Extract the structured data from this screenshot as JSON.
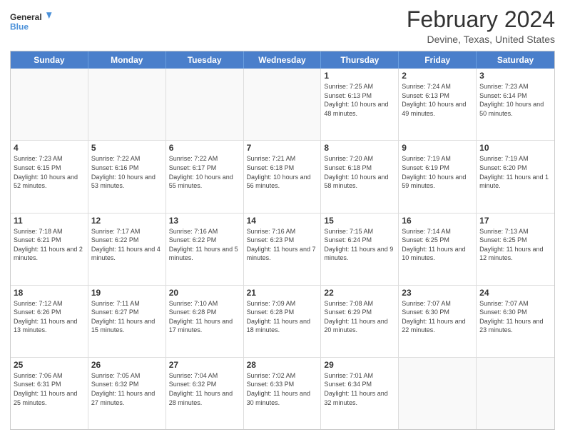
{
  "header": {
    "logo_line1": "General",
    "logo_line2": "Blue",
    "month": "February 2024",
    "location": "Devine, Texas, United States"
  },
  "days": [
    "Sunday",
    "Monday",
    "Tuesday",
    "Wednesday",
    "Thursday",
    "Friday",
    "Saturday"
  ],
  "weeks": [
    [
      {
        "day": "",
        "info": ""
      },
      {
        "day": "",
        "info": ""
      },
      {
        "day": "",
        "info": ""
      },
      {
        "day": "",
        "info": ""
      },
      {
        "day": "1",
        "info": "Sunrise: 7:25 AM\nSunset: 6:13 PM\nDaylight: 10 hours and 48 minutes."
      },
      {
        "day": "2",
        "info": "Sunrise: 7:24 AM\nSunset: 6:13 PM\nDaylight: 10 hours and 49 minutes."
      },
      {
        "day": "3",
        "info": "Sunrise: 7:23 AM\nSunset: 6:14 PM\nDaylight: 10 hours and 50 minutes."
      }
    ],
    [
      {
        "day": "4",
        "info": "Sunrise: 7:23 AM\nSunset: 6:15 PM\nDaylight: 10 hours and 52 minutes."
      },
      {
        "day": "5",
        "info": "Sunrise: 7:22 AM\nSunset: 6:16 PM\nDaylight: 10 hours and 53 minutes."
      },
      {
        "day": "6",
        "info": "Sunrise: 7:22 AM\nSunset: 6:17 PM\nDaylight: 10 hours and 55 minutes."
      },
      {
        "day": "7",
        "info": "Sunrise: 7:21 AM\nSunset: 6:18 PM\nDaylight: 10 hours and 56 minutes."
      },
      {
        "day": "8",
        "info": "Sunrise: 7:20 AM\nSunset: 6:18 PM\nDaylight: 10 hours and 58 minutes."
      },
      {
        "day": "9",
        "info": "Sunrise: 7:19 AM\nSunset: 6:19 PM\nDaylight: 10 hours and 59 minutes."
      },
      {
        "day": "10",
        "info": "Sunrise: 7:19 AM\nSunset: 6:20 PM\nDaylight: 11 hours and 1 minute."
      }
    ],
    [
      {
        "day": "11",
        "info": "Sunrise: 7:18 AM\nSunset: 6:21 PM\nDaylight: 11 hours and 2 minutes."
      },
      {
        "day": "12",
        "info": "Sunrise: 7:17 AM\nSunset: 6:22 PM\nDaylight: 11 hours and 4 minutes."
      },
      {
        "day": "13",
        "info": "Sunrise: 7:16 AM\nSunset: 6:22 PM\nDaylight: 11 hours and 5 minutes."
      },
      {
        "day": "14",
        "info": "Sunrise: 7:16 AM\nSunset: 6:23 PM\nDaylight: 11 hours and 7 minutes."
      },
      {
        "day": "15",
        "info": "Sunrise: 7:15 AM\nSunset: 6:24 PM\nDaylight: 11 hours and 9 minutes."
      },
      {
        "day": "16",
        "info": "Sunrise: 7:14 AM\nSunset: 6:25 PM\nDaylight: 11 hours and 10 minutes."
      },
      {
        "day": "17",
        "info": "Sunrise: 7:13 AM\nSunset: 6:25 PM\nDaylight: 11 hours and 12 minutes."
      }
    ],
    [
      {
        "day": "18",
        "info": "Sunrise: 7:12 AM\nSunset: 6:26 PM\nDaylight: 11 hours and 13 minutes."
      },
      {
        "day": "19",
        "info": "Sunrise: 7:11 AM\nSunset: 6:27 PM\nDaylight: 11 hours and 15 minutes."
      },
      {
        "day": "20",
        "info": "Sunrise: 7:10 AM\nSunset: 6:28 PM\nDaylight: 11 hours and 17 minutes."
      },
      {
        "day": "21",
        "info": "Sunrise: 7:09 AM\nSunset: 6:28 PM\nDaylight: 11 hours and 18 minutes."
      },
      {
        "day": "22",
        "info": "Sunrise: 7:08 AM\nSunset: 6:29 PM\nDaylight: 11 hours and 20 minutes."
      },
      {
        "day": "23",
        "info": "Sunrise: 7:07 AM\nSunset: 6:30 PM\nDaylight: 11 hours and 22 minutes."
      },
      {
        "day": "24",
        "info": "Sunrise: 7:07 AM\nSunset: 6:30 PM\nDaylight: 11 hours and 23 minutes."
      }
    ],
    [
      {
        "day": "25",
        "info": "Sunrise: 7:06 AM\nSunset: 6:31 PM\nDaylight: 11 hours and 25 minutes."
      },
      {
        "day": "26",
        "info": "Sunrise: 7:05 AM\nSunset: 6:32 PM\nDaylight: 11 hours and 27 minutes."
      },
      {
        "day": "27",
        "info": "Sunrise: 7:04 AM\nSunset: 6:32 PM\nDaylight: 11 hours and 28 minutes."
      },
      {
        "day": "28",
        "info": "Sunrise: 7:02 AM\nSunset: 6:33 PM\nDaylight: 11 hours and 30 minutes."
      },
      {
        "day": "29",
        "info": "Sunrise: 7:01 AM\nSunset: 6:34 PM\nDaylight: 11 hours and 32 minutes."
      },
      {
        "day": "",
        "info": ""
      },
      {
        "day": "",
        "info": ""
      }
    ]
  ]
}
